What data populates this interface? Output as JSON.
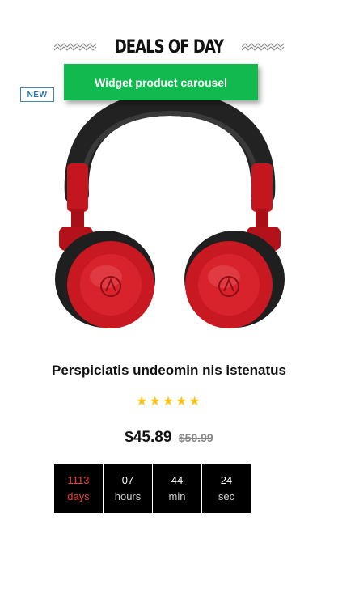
{
  "section": {
    "title": "DEALS OF DAY"
  },
  "banner": {
    "label": "Widget product carousel"
  },
  "badge": {
    "label": "NEW"
  },
  "product": {
    "image_alt": "red-headphones",
    "title": "Perspiciatis undeomin nis istenatus",
    "rating": {
      "stars": 5,
      "max": 5,
      "display": "★★★★★"
    },
    "price": "$45.89",
    "old_price": "$50.99"
  },
  "countdown": [
    {
      "value": "1113",
      "unit": "days"
    },
    {
      "value": "07",
      "unit": "hours"
    },
    {
      "value": "44",
      "unit": "min"
    },
    {
      "value": "24",
      "unit": "sec"
    }
  ],
  "colors": {
    "banner": "#12b94f",
    "badge": "#2e76a3",
    "star": "#f7c419",
    "days": "#e7413c",
    "countdown_bg": "#000000"
  }
}
